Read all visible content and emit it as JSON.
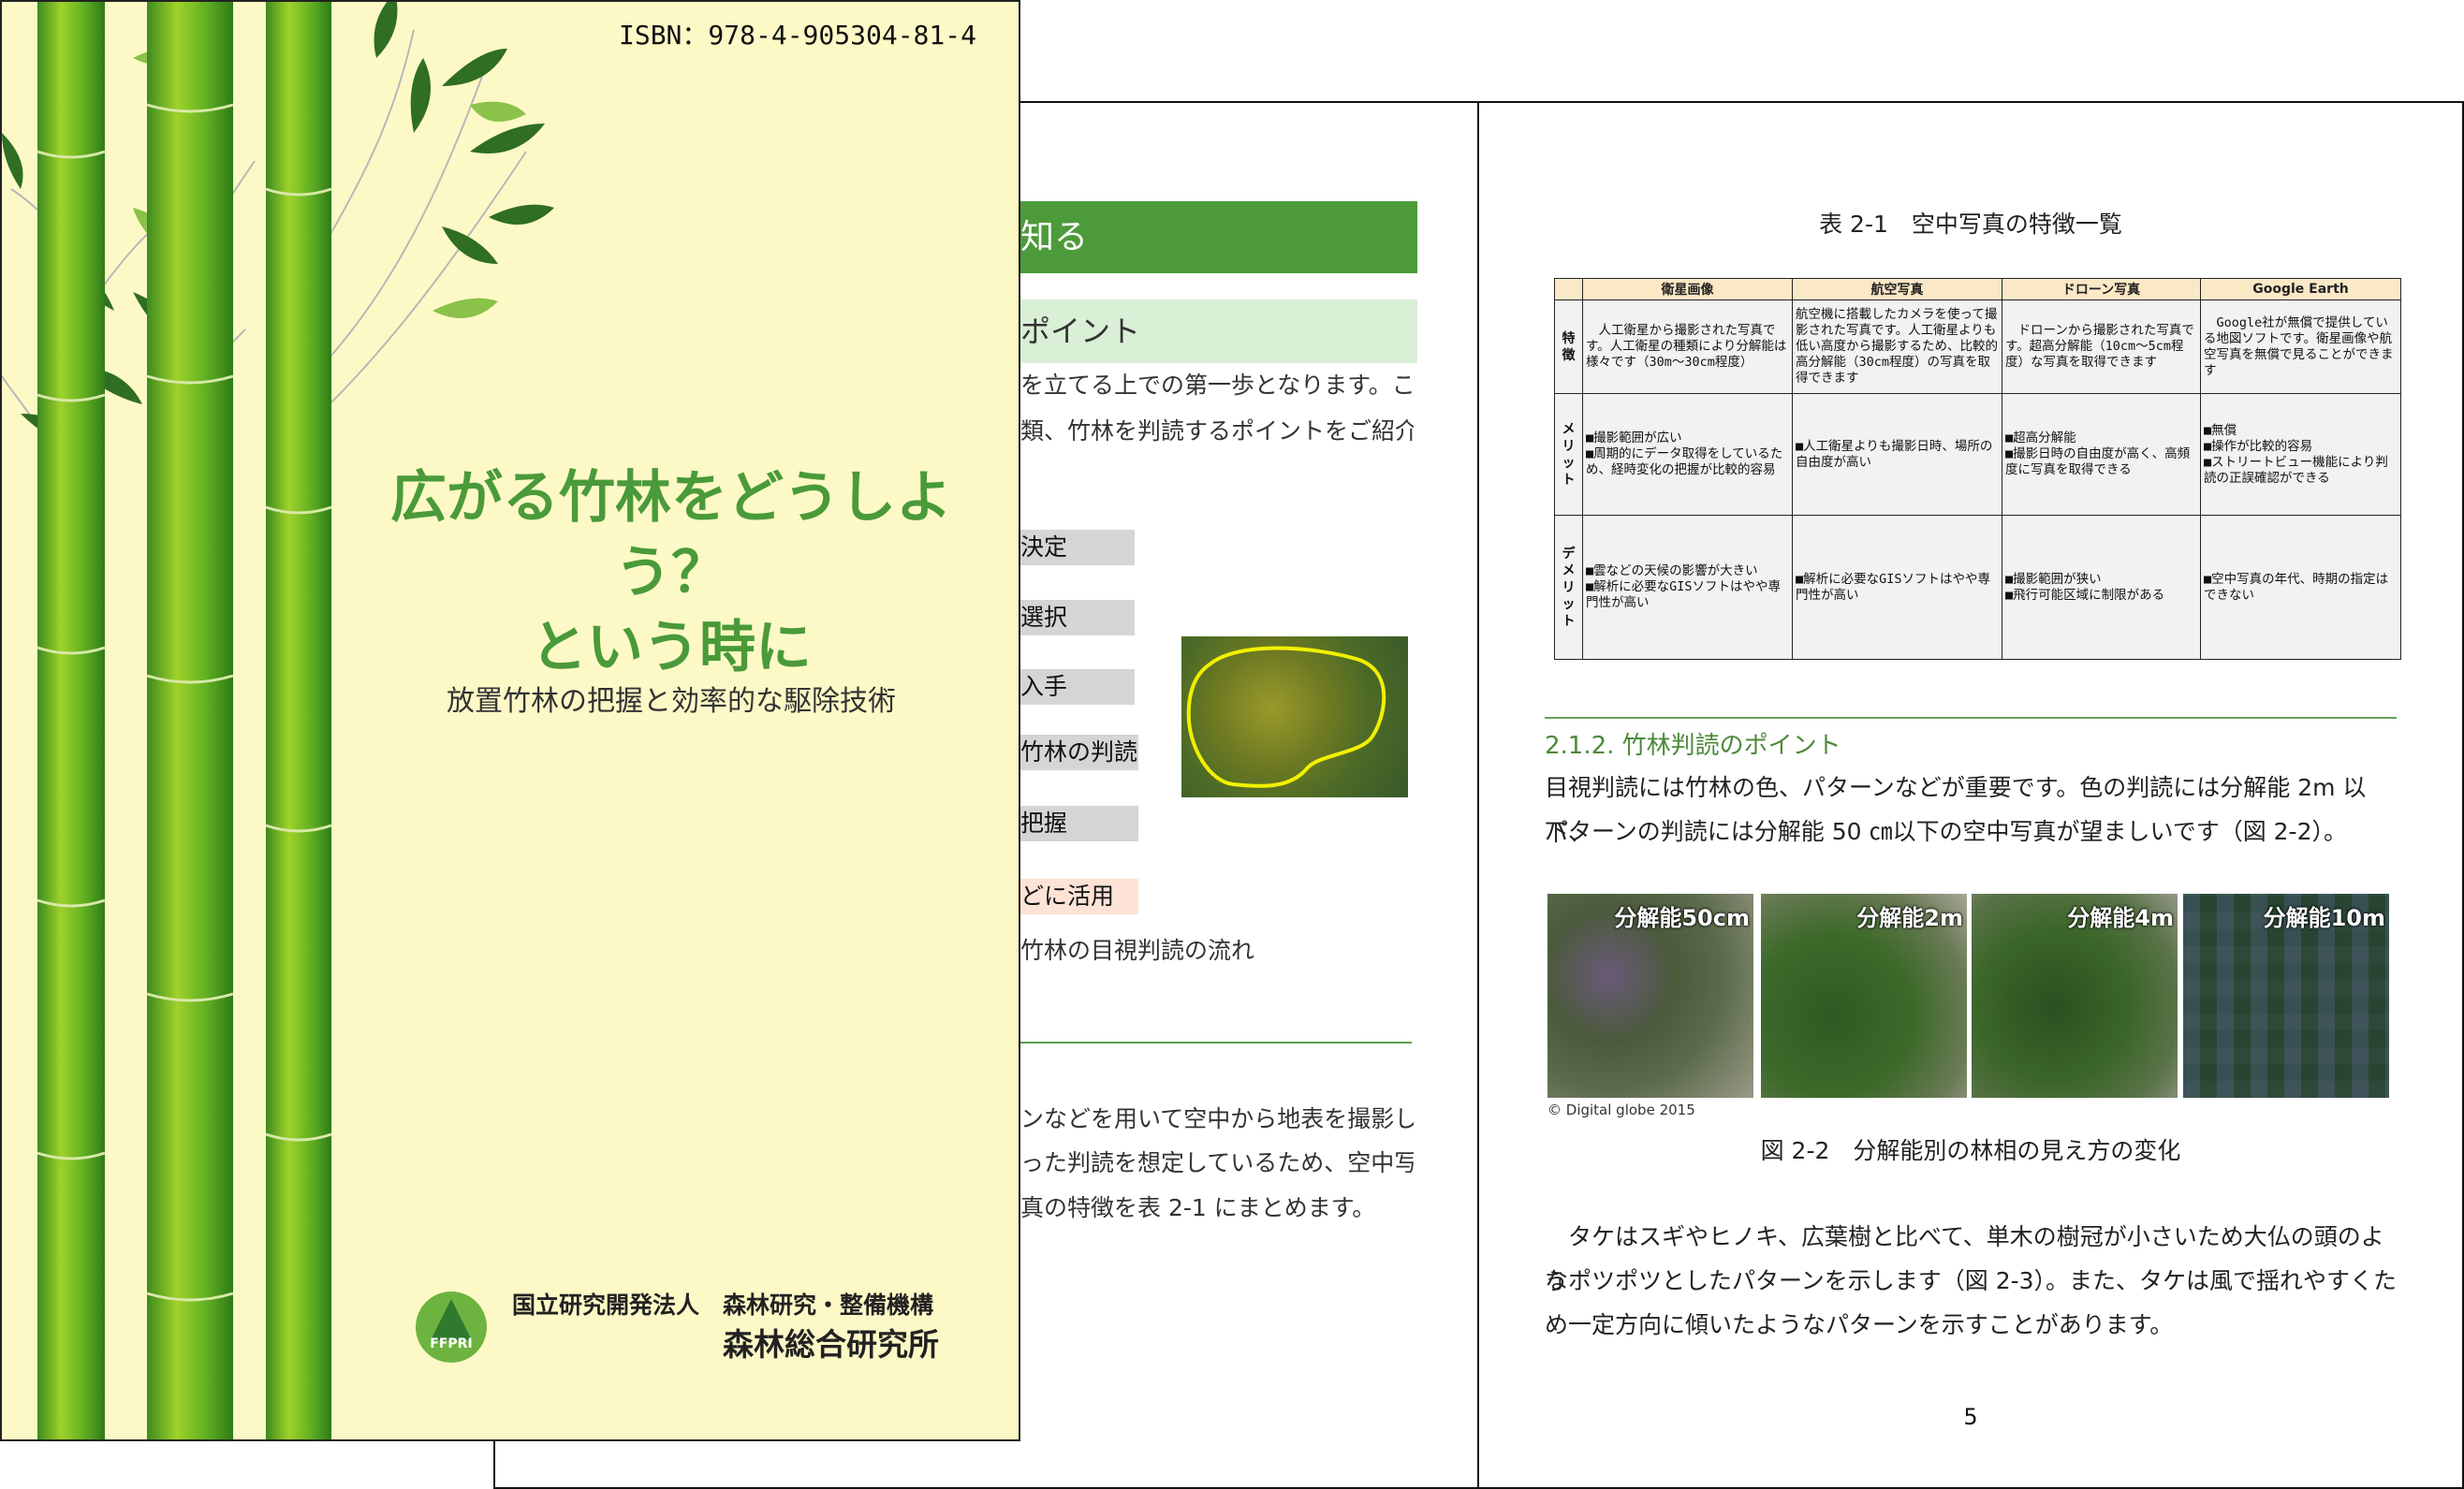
{
  "cover": {
    "isbn": "ISBN：978-4-905304-81-4",
    "title_line1": "広がる竹林をどうしよう？",
    "title_line2": "という時に",
    "subtitle": "放置竹林の把握と効率的な駆除技術",
    "org_line1": "国立研究開発法人　森林研究・整備機構",
    "org_line2": "森林総合研究所",
    "logo_text": "FFPRI"
  },
  "middle_page": {
    "header": "知る",
    "subheader": "ポイント",
    "text_line1": "を立てる上での第一歩となります。こ",
    "text_line2": "類、竹林を判読するポイントをご紹介",
    "flow": [
      "決定",
      "選択",
      "入手",
      "竹林の判読",
      "把握",
      "どに活用"
    ],
    "flow_caption": "竹林の目視判読の流れ",
    "text_line3": "ンなどを用いて空中から地表を撮影し",
    "text_line4": "った判読を想定しているため、空中写",
    "text_line5": "真の特徴を表 2-1 にまとめます。"
  },
  "right_page": {
    "table_caption": "表 2-1　空中写真の特徴一覧",
    "table": {
      "columns": [
        "衛星画像",
        "航空写真",
        "ドローン写真",
        "Google Earth"
      ],
      "rows": [
        {
          "head": "特\n徴",
          "cells": [
            "　人工衛星から撮影された写真です。人工衛星の種類により分解能は様々です（30m～30cm程度）",
            "航空機に搭載したカメラを使って撮影された写真です。人工衛星よりも低い高度から撮影するため、比較的高分解能（30cm程度）の写真を取得できます",
            "　ドローンから撮影された写真です。超高分解能（10cm～5cm程度）な写真を取得できます",
            "　Google社が無償で提供している地図ソフトです。衛星画像や航空写真を無償で見ることができます"
          ]
        },
        {
          "head": "メ\nリ\nッ\nト",
          "cells": [
            "■撮影範囲が広い\n■周期的にデータ取得をしているため、経時変化の把握が比較的容易",
            "■人工衛星よりも撮影日時、場所の自由度が高い",
            "■超高分解能\n■撮影日時の自由度が高く、高頻度に写真を取得できる",
            "■無償\n■操作が比較的容易\n■ストリートビュー機能により判読の正誤確認ができる"
          ]
        },
        {
          "head": "デ\nメ\nリ\nッ\nト",
          "cells": [
            "■雲などの天候の影響が大きい\n■解析に必要なGISソフトはやや専門性が高い",
            "■解析に必要なGISソフトはやや専門性が高い",
            "■撮影範囲が狭い\n■飛行可能区域に制限がある",
            "■空中写真の年代、時期の指定はできない"
          ]
        }
      ]
    },
    "section_heading": "2.1.2. 竹林判読のポイント",
    "para1_line1": "目視判読には竹林の色、パターンなどが重要です。色の判読には分解能 2m 以下、",
    "para1_line2": "パターンの判読には分解能 50 ㎝以下の空中写真が望ましいです（図 2-2）。",
    "images": [
      "分解能50cm",
      "分解能2m",
      "分解能4m",
      "分解能10m"
    ],
    "copyright": "© Digital globe 2015",
    "figure_caption": "図 2-2　分解能別の林相の見え方の変化",
    "para2_line1": "　タケはスギやヒノキ、広葉樹と比べて、単木の樹冠が小さいため大仏の頭のよう",
    "para2_line2": "なポツポツとしたパターンを示します（図 2-3）。また、タケは風で揺れやすくた",
    "para2_line3": "め一定方向に傾いたようなパターンを示すことがあります。",
    "page_number": "5"
  },
  "colors": {
    "cover_bg": "#fdf9c6",
    "title_green": "#4a9a3a",
    "header_green": "#4d9a3a",
    "table_header": "#fbe8c6"
  }
}
